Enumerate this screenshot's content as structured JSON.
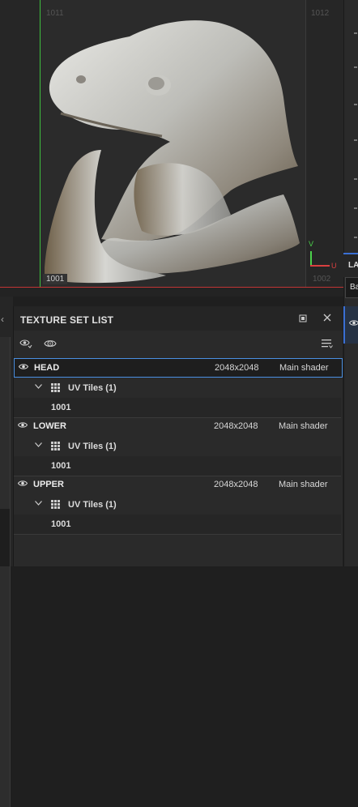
{
  "viewport": {
    "tiles": {
      "main": "1001",
      "top_left": "1011",
      "top_right": "1012",
      "bottom_right": "1002"
    },
    "axis": {
      "v": "V",
      "u": "U"
    }
  },
  "right_strip": {
    "layers_tab": "LA",
    "field_text": "Ba"
  },
  "texture_set_list": {
    "title": "TEXTURE SET LIST",
    "sets": [
      {
        "name": "HEAD",
        "resolution": "2048x2048",
        "shader": "Main shader",
        "uv_label": "UV Tiles (1)",
        "tile": "1001",
        "selected": true
      },
      {
        "name": "LOWER",
        "resolution": "2048x2048",
        "shader": "Main shader",
        "uv_label": "UV Tiles (1)",
        "tile": "1001",
        "selected": false
      },
      {
        "name": "UPPER",
        "resolution": "2048x2048",
        "shader": "Main shader",
        "uv_label": "UV Tiles (1)",
        "tile": "1001",
        "selected": false
      }
    ]
  },
  "colors": {
    "accent": "#4a90e2",
    "u_axis": "#d94040",
    "v_axis": "#4bd14b",
    "panel_bg": "#2a2a2a"
  },
  "icons": [
    "eye-icon",
    "eye-plus-icon",
    "info-icon",
    "maximize-icon",
    "close-icon",
    "list-menu-icon",
    "grid-icon",
    "chevron-down-icon",
    "chevron-left-icon"
  ]
}
